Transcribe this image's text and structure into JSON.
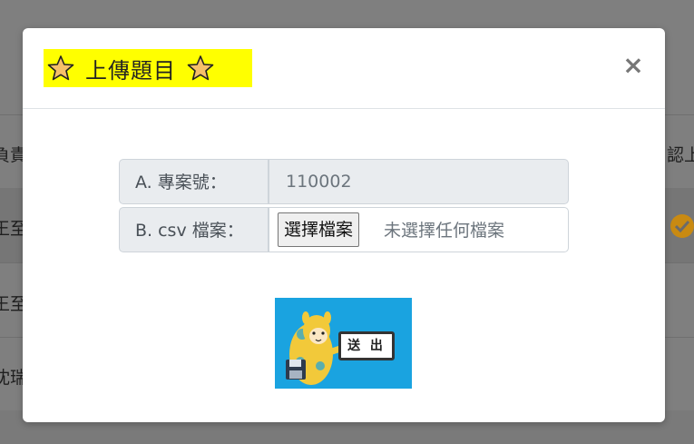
{
  "background": {
    "row_texts": [
      "負責",
      "王至",
      "王至",
      "沈瑞"
    ],
    "right_text": "認上"
  },
  "modal": {
    "title": "上傳題目",
    "close_label": "×",
    "fields": {
      "project": {
        "label": "A. 專案號：",
        "value": "110002"
      },
      "csv": {
        "label": "B. csv 檔案：",
        "button": "選擇檔案",
        "status": "未選擇任何檔案"
      }
    },
    "submit": {
      "text": "送 出"
    }
  },
  "colors": {
    "title_highlight": "#ffff00",
    "submit_bg": "#1aa3e0",
    "overlay": "#7f7f7f"
  }
}
